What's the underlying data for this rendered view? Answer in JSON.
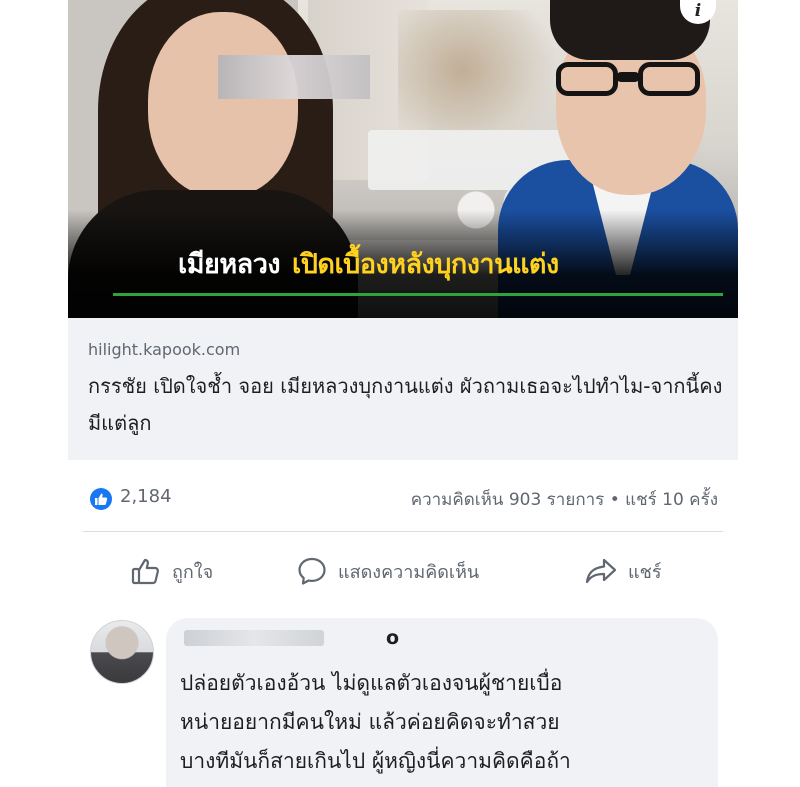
{
  "post": {
    "image": {
      "headline_white": "เมียหลวง",
      "headline_yellow": "เปิดเบื้องหลังบุกงานแต่ง",
      "info_icon": "info-icon"
    },
    "link": {
      "domain": "hilight.kapook.com",
      "title": "กรรชัย เปิดใจช้ำ จอย เมียหลวงบุกงานแต่ง ผัวถามเธอจะไปทำไม-จากนี้คงมีแต่ลูก"
    },
    "stats": {
      "like_count": "2,184",
      "counts_text": "ความคิดเห็น 903 รายการ • แชร์ 10 ครั้ง"
    },
    "actions": {
      "like_label": "ถูกใจ",
      "comment_label": "แสดงความคิดเห็น",
      "share_label": "แชร์"
    }
  },
  "comment": {
    "author_visible": "o",
    "text": "ปล่อยตัวเองอ้วน ไม่ดูแลตัวเองจนผู้ชายเบื่อ\nหน่ายอยากมีคนใหม่ แล้วค่อยคิดจะทำสวย\nบางทีมันก็สายเกินไป ผู้หญิงนี่ความคิดคือถ้า"
  },
  "colors": {
    "facebook_blue": "#1877f2",
    "headline_yellow": "#ffd21f",
    "accent_green": "#2fa43c",
    "meta_gray": "#606770",
    "link_bg": "#f0f2f5"
  }
}
